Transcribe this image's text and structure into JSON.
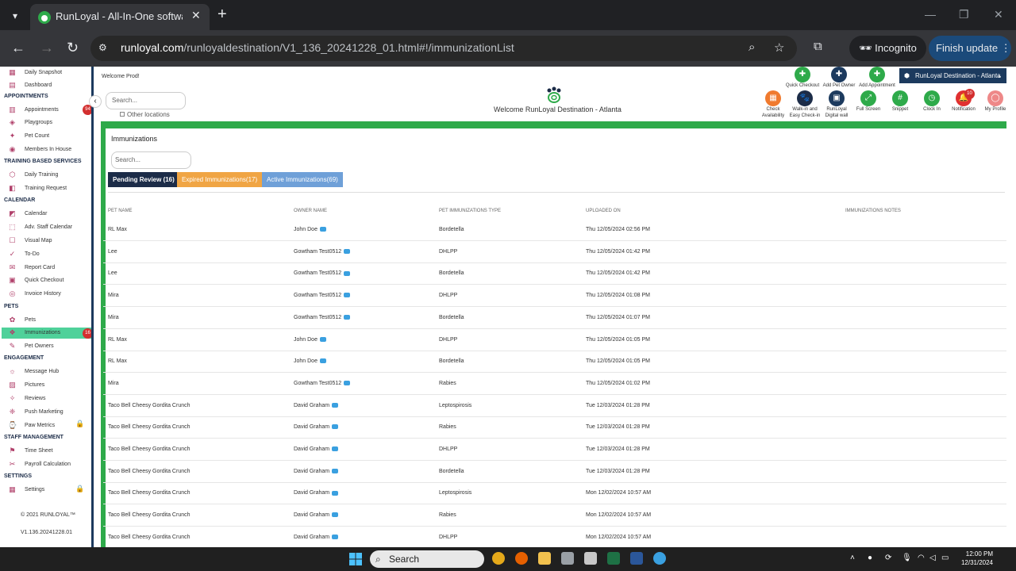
{
  "browser": {
    "tab_title": "RunLoyal - All-In-One software",
    "url_host": "runloyal.com",
    "url_path": "/runloyaldestination/V1_136_20241228_01.html#!/immunizationList",
    "incognito_label": "Incognito",
    "finish_update_label": "Finish update"
  },
  "sidebar": {
    "items_top": [
      {
        "label": "Daily Snapshot",
        "icon": "snapshot-icon"
      },
      {
        "label": "Dashboard",
        "icon": "dashboard-icon"
      }
    ],
    "sections": [
      {
        "title": "APPOINTMENTS",
        "items": [
          {
            "label": "Appointments",
            "badge": "94"
          },
          {
            "label": "Playgroups"
          },
          {
            "label": "Pet Count"
          },
          {
            "label": "Members In House"
          }
        ]
      },
      {
        "title": "TRAINING BASED SERVICES",
        "items": [
          {
            "label": "Daily Training"
          },
          {
            "label": "Training Request"
          }
        ]
      },
      {
        "title": "CALENDAR",
        "items": [
          {
            "label": "Calendar"
          },
          {
            "label": "Adv. Staff Calendar"
          },
          {
            "label": "Visual Map"
          },
          {
            "label": "To-Do"
          },
          {
            "label": "Report Card"
          },
          {
            "label": "Quick Checkout"
          },
          {
            "label": "Invoice History"
          }
        ]
      },
      {
        "title": "PETS",
        "items": [
          {
            "label": "Pets"
          },
          {
            "label": "Immunizations",
            "badge": "16",
            "active": true
          },
          {
            "label": "Pet Owners"
          }
        ]
      },
      {
        "title": "ENGAGEMENT",
        "items": [
          {
            "label": "Message Hub"
          },
          {
            "label": "Pictures"
          },
          {
            "label": "Reviews"
          },
          {
            "label": "Push Marketing"
          },
          {
            "label": "Paw Metrics",
            "locked": true
          }
        ]
      },
      {
        "title": "STAFF MANAGEMENT",
        "items": [
          {
            "label": "Time Sheet"
          },
          {
            "label": "Payroll Calculation"
          }
        ]
      },
      {
        "title": "SETTINGS",
        "items": [
          {
            "label": "Settings",
            "locked": true
          }
        ]
      }
    ],
    "copyright": "© 2021  RUNLOYAL™",
    "version": "V1.136.20241228.01"
  },
  "header": {
    "welcome_user": "Welcome Prod!",
    "search_placeholder": "Search...",
    "other_locations": "Other locations",
    "welcome_location": "Welcome RunLoyal Destination - Atlanta",
    "location_select": "RunLoyal Destination - Atlanta",
    "top_actions": [
      "Quick Checkout",
      "Add Pet Owner",
      "Add Appointment"
    ],
    "bottom_actions": [
      {
        "l1": "Check",
        "l2": "Availability"
      },
      {
        "l1": "Walk-in and",
        "l2": "Easy Check-in"
      },
      {
        "l1": "RunLoyal",
        "l2": "Digital wall"
      },
      {
        "l1": "Full Screen",
        "l2": ""
      },
      {
        "l1": "Snippet",
        "l2": ""
      },
      {
        "l1": "Clock In",
        "l2": ""
      },
      {
        "l1": "Notification",
        "l2": ""
      },
      {
        "l1": "My Profile",
        "l2": ""
      }
    ],
    "notification_count": "10"
  },
  "panel": {
    "title": "Immunizations",
    "search_placeholder": "Search...",
    "tabs": [
      {
        "label": "Pending Review (16)",
        "color": "#1c2c48"
      },
      {
        "label": "Expired Immunizations(17)",
        "color": "#f0a544"
      },
      {
        "label": "Active Immunizations(69)",
        "color": "#6fa0d8"
      }
    ],
    "columns": [
      "PET NAME",
      "OWNER NAME",
      "PET IMMUNIZATIONS TYPE",
      "UPLOADED ON",
      "IMMUNIZATIONS NOTES"
    ],
    "rows": [
      {
        "pet": "RL Max",
        "owner": "John Doe",
        "type": "Bordetella",
        "uploaded": "Thu 12/05/2024 02:56 PM"
      },
      {
        "pet": "Lee",
        "owner": "Gowtham Test0512",
        "type": "DHLPP",
        "uploaded": "Thu 12/05/2024 01:42 PM"
      },
      {
        "pet": "Lee",
        "owner": "Gowtham Test0512",
        "type": "Bordetella",
        "uploaded": "Thu 12/05/2024 01:42 PM"
      },
      {
        "pet": "Mira",
        "owner": "Gowtham Test0512",
        "type": "DHLPP",
        "uploaded": "Thu 12/05/2024 01:08 PM"
      },
      {
        "pet": "Mira",
        "owner": "Gowtham Test0512",
        "type": "Bordetella",
        "uploaded": "Thu 12/05/2024 01:07 PM"
      },
      {
        "pet": "RL Max",
        "owner": "John Doe",
        "type": "DHLPP",
        "uploaded": "Thu 12/05/2024 01:05 PM"
      },
      {
        "pet": "RL Max",
        "owner": "John Doe",
        "type": "Bordetella",
        "uploaded": "Thu 12/05/2024 01:05 PM"
      },
      {
        "pet": "Mira",
        "owner": "Gowtham Test0512",
        "type": "Rabies",
        "uploaded": "Thu 12/05/2024 01:02 PM"
      },
      {
        "pet": "Taco Bell Cheesy Gordita Crunch",
        "owner": "David Graham",
        "type": "Leptospirosis",
        "uploaded": "Tue 12/03/2024 01:28 PM"
      },
      {
        "pet": "Taco Bell Cheesy Gordita Crunch",
        "owner": "David Graham",
        "type": "Rabies",
        "uploaded": "Tue 12/03/2024 01:28 PM"
      },
      {
        "pet": "Taco Bell Cheesy Gordita Crunch",
        "owner": "David Graham",
        "type": "DHLPP",
        "uploaded": "Tue 12/03/2024 01:28 PM"
      },
      {
        "pet": "Taco Bell Cheesy Gordita Crunch",
        "owner": "David Graham",
        "type": "Bordetella",
        "uploaded": "Tue 12/03/2024 01:28 PM"
      },
      {
        "pet": "Taco Bell Cheesy Gordita Crunch",
        "owner": "David Graham",
        "type": "Leptospirosis",
        "uploaded": "Mon 12/02/2024 10:57 AM"
      },
      {
        "pet": "Taco Bell Cheesy Gordita Crunch",
        "owner": "David Graham",
        "type": "Rabies",
        "uploaded": "Mon 12/02/2024 10:57 AM"
      },
      {
        "pet": "Taco Bell Cheesy Gordita Crunch",
        "owner": "David Graham",
        "type": "DHLPP",
        "uploaded": "Mon 12/02/2024 10:57 AM"
      }
    ]
  },
  "taskbar": {
    "search_label": "Search",
    "time": "12:00 PM",
    "date": "12/31/2024"
  }
}
